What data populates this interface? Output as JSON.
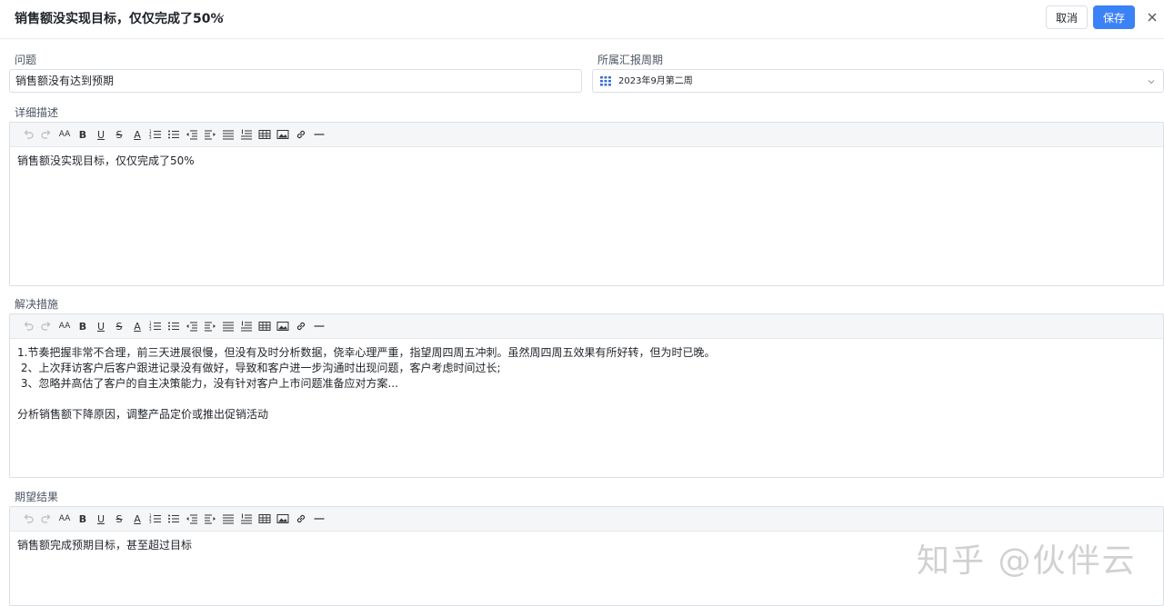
{
  "header": {
    "title": "销售额没实现目标，仅仅完成了50%",
    "cancel_label": "取消",
    "save_label": "保存"
  },
  "fields": {
    "issue_label": "问题",
    "issue_value": "销售额没有达到预期",
    "period_label": "所属汇报周期",
    "period_value": "2023年9月第二周",
    "detail_label": "详细描述",
    "detail_value": "销售额没实现目标，仅仅完成了50%",
    "solution_label": "解决措施",
    "solution_value": "1.节奏把握非常不合理，前三天进展很慢，但没有及时分析数据，侥幸心理严重，指望周四周五冲刺。虽然周四周五效果有所好转，但为时已晚。\n 2、上次拜访客户后客户跟进记录没有做好，导致和客户进一步沟通时出现问题，客户考虑时间过长;\n 3、忽略并高估了客户的自主决策能力，没有针对客户上市问题准备应对方案...\n\n分析销售额下降原因，调整产品定价或推出促销活动",
    "expected_label": "期望结果",
    "expected_value": "销售额完成预期目标，甚至超过目标"
  },
  "toolbar": {
    "font_size_glyph": "AA",
    "bold_glyph": "B",
    "underline_glyph": "U",
    "strike_glyph": "S",
    "color_glyph": "A"
  },
  "watermark": "知乎 @伙伴云",
  "colors": {
    "accent": "#3b82f6",
    "border": "#dcdfe6",
    "toolbar_bg": "#f5f6f7"
  }
}
